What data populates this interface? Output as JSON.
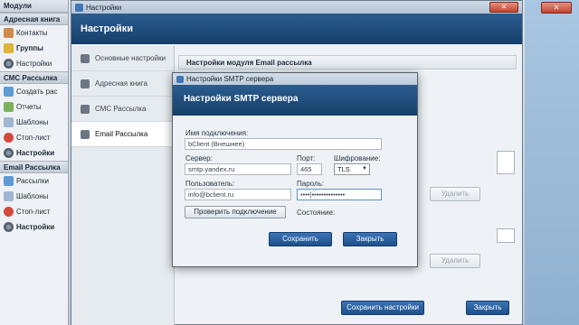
{
  "sidebar": {
    "header": "Модули",
    "sections": [
      {
        "title": "Адресная книга",
        "items": [
          {
            "label": "Контакты",
            "icon": "contacts-icon",
            "bold": false
          },
          {
            "label": "Группы",
            "icon": "groups-icon",
            "bold": true
          },
          {
            "label": "Настройки",
            "icon": "gear-icon",
            "bold": false
          }
        ]
      },
      {
        "title": "СМС Рассылка",
        "items": [
          {
            "label": "Создать рас",
            "icon": "send-icon",
            "bold": false
          },
          {
            "label": "Отчеты",
            "icon": "report-icon",
            "bold": false
          },
          {
            "label": "Шаблоны",
            "icon": "template-icon",
            "bold": false
          },
          {
            "label": "Стоп-лист",
            "icon": "stop-icon",
            "bold": false
          },
          {
            "label": "Настройки",
            "icon": "gear-icon",
            "bold": true
          }
        ]
      },
      {
        "title": "Email Рассылка",
        "items": [
          {
            "label": "Рассылки",
            "icon": "send-icon",
            "bold": false
          },
          {
            "label": "Шаблоны",
            "icon": "template-icon",
            "bold": false
          },
          {
            "label": "Стоп-лист",
            "icon": "stop-icon",
            "bold": false
          },
          {
            "label": "Настройки",
            "icon": "gear-icon",
            "bold": true
          }
        ]
      }
    ]
  },
  "settings_window": {
    "title": "Настройки",
    "banner": "Настройки",
    "close_glyph": "✕",
    "tabs": [
      {
        "label": "Основные настройки",
        "active": false
      },
      {
        "label": "Адресная книга",
        "active": false
      },
      {
        "label": "СМС Рассылка",
        "active": false
      },
      {
        "label": "Email Рассылка",
        "active": true
      }
    ],
    "content_header": "Настройки модуля Email рассылка",
    "delete_label_1": "Удалить",
    "delete_label_2": "Удалить",
    "save_settings_label": "Сохранить настройки",
    "close_label": "Закрыть"
  },
  "smtp_dialog": {
    "title": "Настройки SMTP сервера",
    "banner": "Настройки SMTP сервера",
    "connection_name_label": "Имя подключения:",
    "connection_name_value": "bClient (Внешнее)",
    "server_label": "Сервер:",
    "server_value": "smtp.yandex.ru",
    "port_label": "Порт:",
    "port_value": "465",
    "encryption_label": "Шифрование:",
    "encryption_value": "TLS",
    "user_label": "Пользователь:",
    "user_value": "info@bclient.ru",
    "password_label": "Пароль:",
    "password_value": "••••|••••••••••••••",
    "check_connection_label": "Проверить подключение",
    "status_label": "Состояние:",
    "save_label": "Сохранить",
    "close_label": "Закрыть"
  },
  "desktop": {
    "close_glyph": "✕"
  }
}
